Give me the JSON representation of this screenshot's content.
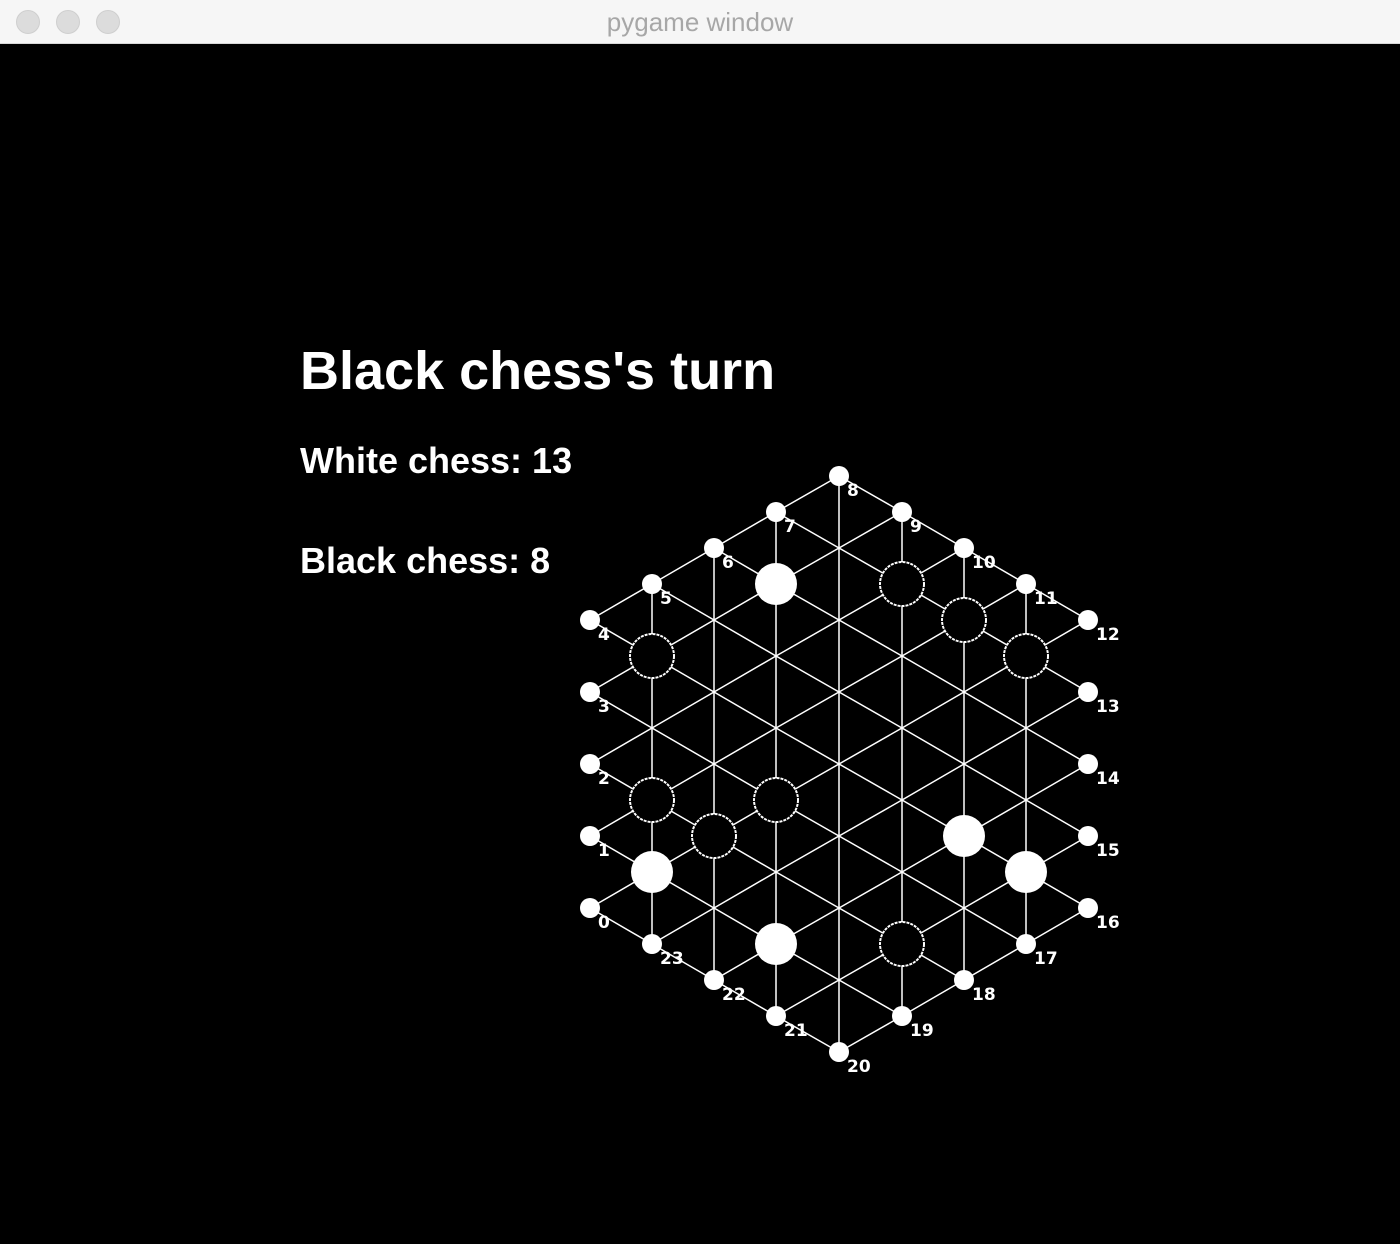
{
  "window": {
    "title": "pygame window",
    "buttons": [
      "close",
      "minimize",
      "zoom"
    ]
  },
  "status": {
    "turn": "Black chess's turn",
    "white_count": "White chess: 13",
    "black_count": "Black chess: 8"
  },
  "colors": {
    "background": "#000000",
    "lines": "#ffffff",
    "pieces": "#ffffff",
    "text": "#ffffff"
  },
  "board": {
    "shape": "hexagonal triangular grid",
    "edge_node_labels": [
      "0",
      "1",
      "2",
      "3",
      "4",
      "5",
      "6",
      "7",
      "8",
      "9",
      "10",
      "11",
      "12",
      "13",
      "14",
      "15",
      "16",
      "17",
      "18",
      "19",
      "20",
      "21",
      "22",
      "23"
    ],
    "white_pieces": [
      [
        2,
        5
      ],
      [
        5,
        0
      ],
      [
        5,
        4
      ],
      [
        5,
        8
      ],
      [
        6,
        1
      ],
      [
        7,
        2
      ],
      [
        7,
        6
      ]
    ],
    "black_pieces": [
      [
        0,
        4
      ],
      [
        1,
        4
      ],
      [
        2,
        5
      ],
      [
        2,
        0
      ],
      [
        3,
        1
      ],
      [
        3,
        8
      ],
      [
        4,
        3
      ],
      [
        5,
        6
      ]
    ]
  }
}
